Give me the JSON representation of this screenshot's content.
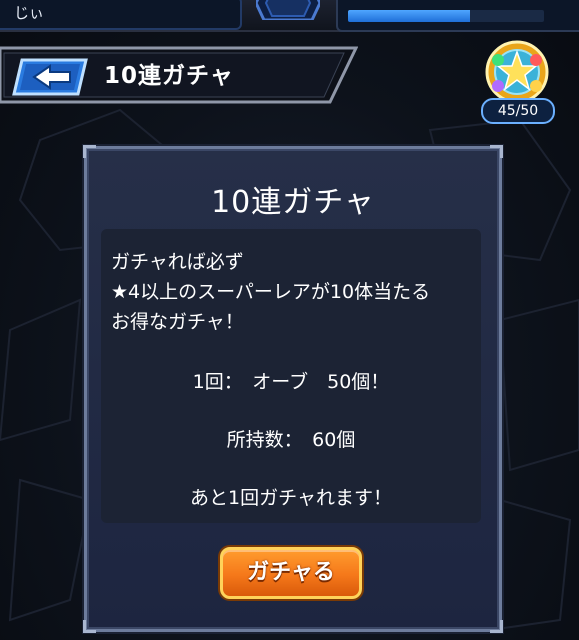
{
  "top_bar": {
    "player_name": "じぃ",
    "stamina_fraction": 0.62
  },
  "header": {
    "title": "10連ガチャ"
  },
  "orb_counter": {
    "count_text": "45/50"
  },
  "dialog": {
    "title": "10連ガチャ",
    "description_lines": [
      "ガチャれば必ず",
      "★4以上のスーパーレアが10体当たる",
      "お得なガチャ！"
    ],
    "cost_line": "1回：　オーブ　50個！",
    "owned_line": "所持数：　60個",
    "remaining_line": "あと1回ガチャれます！",
    "button_label": "ガチャる"
  },
  "colors": {
    "accent_orange": "#f5781a",
    "dialog_bg": "#262f48",
    "back_button_blue": "#2a7be0"
  }
}
